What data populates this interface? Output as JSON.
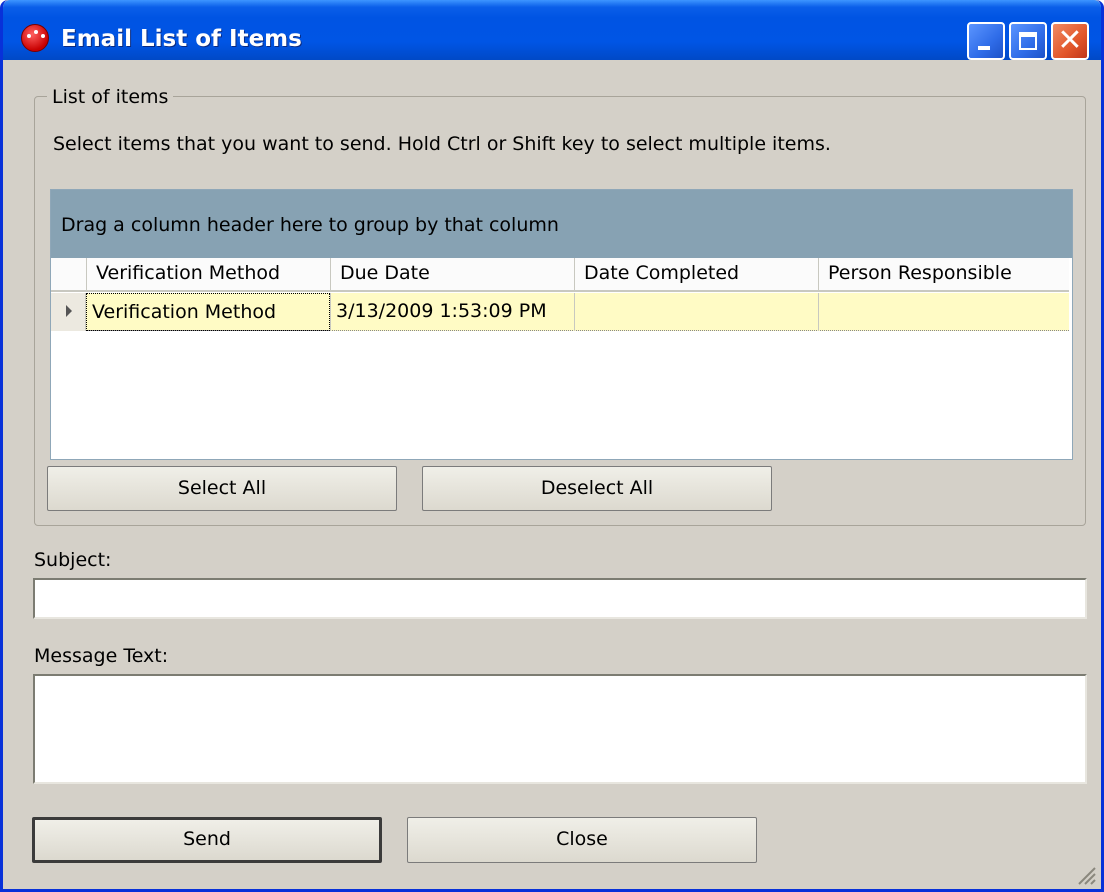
{
  "window": {
    "title": "Email List of Items",
    "controls": [
      "minimize-icon",
      "maximize-icon",
      "close-icon"
    ]
  },
  "list_group": {
    "legend": "List of items",
    "instructions": "Select items that you want to send. Hold Ctrl or Shift key to select multiple items."
  },
  "grid": {
    "group_hint": "Drag a column header here to group by that column",
    "columns": [
      "Verification Method",
      "Due Date",
      "Date Completed",
      "Person Responsible"
    ],
    "rows": [
      {
        "cells": [
          "Verification Method",
          "3/13/2009 1:53:09 PM",
          "",
          ""
        ],
        "selected": true
      }
    ]
  },
  "buttons": {
    "select_all": "Select All",
    "deselect_all": "Deselect All",
    "send": "Send",
    "close": "Close"
  },
  "subject": {
    "label": "Subject:",
    "value": ""
  },
  "message": {
    "label": "Message Text:",
    "value": ""
  },
  "colors": {
    "titlebar": "#0054e3",
    "window_bg": "#d4d0c8",
    "group_panel": "#87a2b3",
    "selected_row": "#fffbc5"
  }
}
